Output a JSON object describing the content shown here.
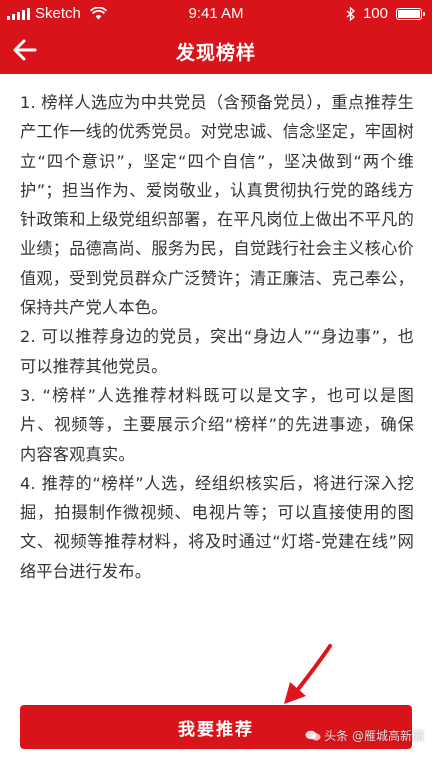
{
  "status": {
    "carrier": "Sketch",
    "time": "9:41 AM",
    "battery": "100",
    "signal_icon": "signal-bars-icon",
    "wifi_icon": "wifi-icon",
    "bluetooth_icon": "bluetooth-icon"
  },
  "header": {
    "title": "发现榜样",
    "back_icon": "arrow-left-icon",
    "bg_color": "#d8141a"
  },
  "content": {
    "paragraphs": [
      "1. 榜样人选应为中共党员（含预备党员），重点推荐生产工作一线的优秀党员。对党忠诚、信念坚定，牢固树立“四个意识”，坚定“四个自信”，坚决做到“两个维护”；担当作为、爱岗敬业，认真贯彻执行党的路线方针政策和上级党组织部署，在平凡岗位上做出不平凡的业绩；品德高尚、服务为民，自觉践行社会主义核心价值观，受到党员群众广泛赞许；清正廉洁、克己奉公，保持共产党人本色。",
      "2. 可以推荐身边的党员，突出“身边人”“身边事”，也可以推荐其他党员。",
      "3. “榜样”人选推荐材料既可以是文字，也可以是图片、视频等，主要展示介绍“榜样”的先进事迹，确保内容客观真实。",
      "4. 推荐的“榜样”人选，经组织核实后，将进行深入挖掘，拍摄制作微视频、电视片等；可以直接使用的图文、视频等推荐材料，将及时通过“灯塔-党建在线”网络平台进行发布。"
    ]
  },
  "action": {
    "recommend_label": "我要推荐",
    "pointer_icon": "red-arrow-pointer-icon"
  },
  "watermark": {
    "text": "头条 @雁城高新园"
  }
}
